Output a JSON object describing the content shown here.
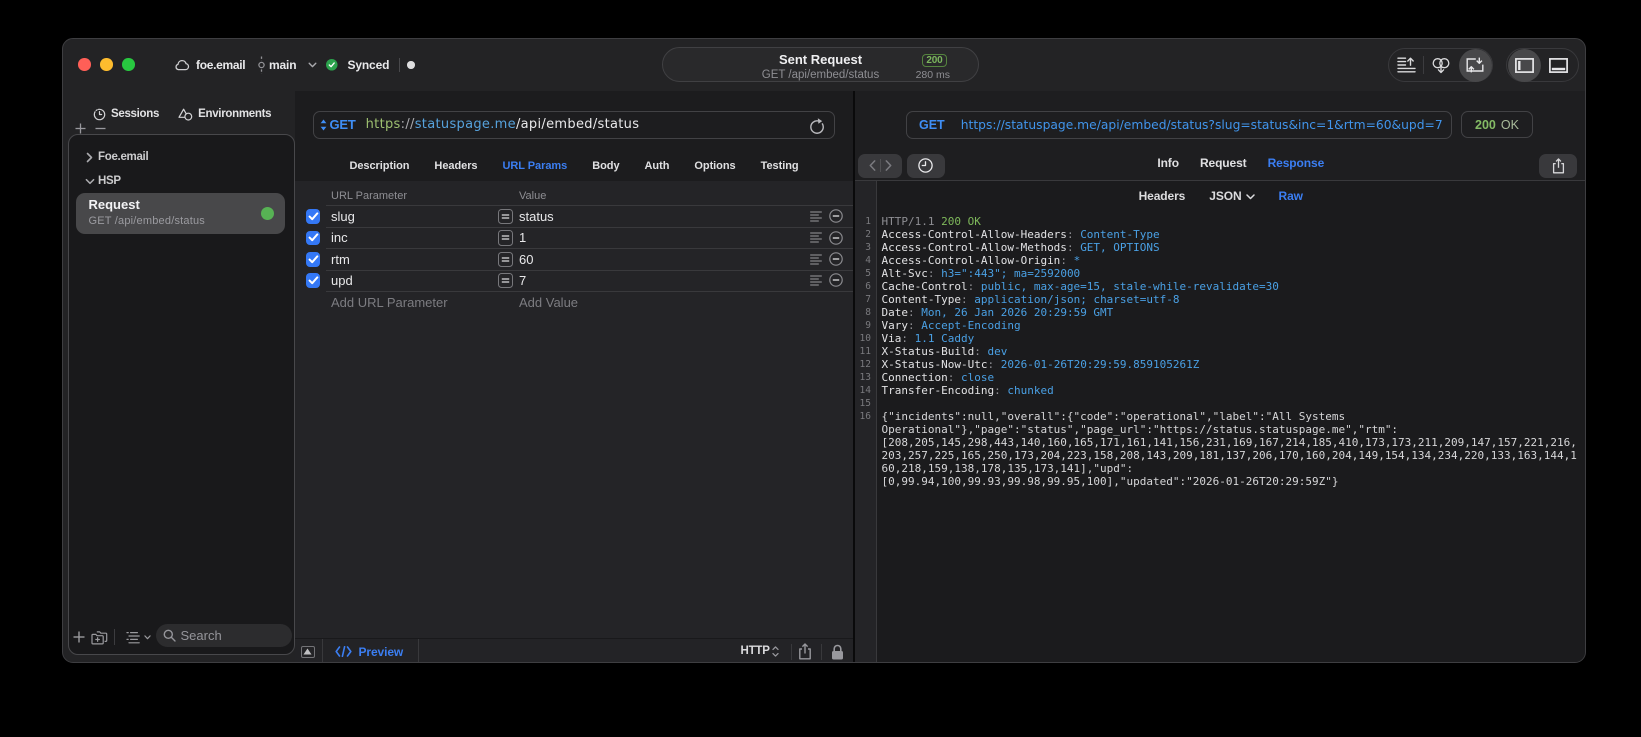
{
  "title_bar": {
    "project": "foe.email",
    "branch": "main",
    "sync_status": "Synced",
    "toast": {
      "title": "Sent Request",
      "subtitle": "GET /api/embed/status",
      "status_code": "200",
      "duration": "280 ms"
    }
  },
  "sidebar": {
    "tabs": [
      {
        "label": "Sessions",
        "icon": "clock-history-icon"
      },
      {
        "label": "Environments",
        "icon": "environments-icon"
      }
    ],
    "tree": [
      {
        "label": "Foe.email",
        "expanded": false
      },
      {
        "label": "HSP",
        "expanded": true
      }
    ],
    "selected_request": {
      "name": "Request",
      "summary": "GET /api/embed/status",
      "status_dot_color": "#57b254"
    },
    "search_placeholder": "Search"
  },
  "request_pane": {
    "method": "GET",
    "url": {
      "scheme": "https",
      "separator": "://",
      "host": "statuspage.me",
      "path": "/api/embed/status"
    },
    "tabs": [
      "Description",
      "Headers",
      "URL Params",
      "Body",
      "Auth",
      "Options",
      "Testing"
    ],
    "active_tab": "URL Params",
    "param_table": {
      "columns": [
        "URL Parameter",
        "Value"
      ],
      "rows": [
        {
          "name": "slug",
          "value": "status",
          "enabled": true
        },
        {
          "name": "inc",
          "value": "1",
          "enabled": true
        },
        {
          "name": "rtm",
          "value": "60",
          "enabled": true
        },
        {
          "name": "upd",
          "value": "7",
          "enabled": true
        }
      ],
      "add_param_placeholder": "Add URL Parameter",
      "add_value_placeholder": "Add Value"
    },
    "footer": {
      "preview_label": "Preview",
      "protocol": "HTTP"
    }
  },
  "response_pane": {
    "request_line": {
      "method": "GET",
      "url": "https://statuspage.me/api/embed/status?slug=status&inc=1&rtm=60&upd=7"
    },
    "status": {
      "code": "200",
      "text": "OK"
    },
    "tabs": [
      "Info",
      "Request",
      "Response"
    ],
    "active_tab": "Response",
    "subtabs": [
      "Headers",
      "JSON",
      "Raw"
    ],
    "active_subtab": "Raw",
    "status_line": {
      "protocol": "HTTP/1.1",
      "status": "200 OK"
    },
    "headers": [
      {
        "name": "Access-Control-Allow-Headers",
        "value": "Content-Type"
      },
      {
        "name": "Access-Control-Allow-Methods",
        "value": "GET, OPTIONS"
      },
      {
        "name": "Access-Control-Allow-Origin",
        "value": "*"
      },
      {
        "name": "Alt-Svc",
        "value": "h3=\":443\"; ma=2592000"
      },
      {
        "name": "Cache-Control",
        "value": "public, max-age=15, stale-while-revalidate=30"
      },
      {
        "name": "Content-Type",
        "value": "application/json; charset=utf-8"
      },
      {
        "name": "Date",
        "value": "Mon, 26 Jan 2026 20:29:59 GMT"
      },
      {
        "name": "Vary",
        "value": "Accept-Encoding"
      },
      {
        "name": "Via",
        "value": "1.1 Caddy"
      },
      {
        "name": "X-Status-Build",
        "value": "dev"
      },
      {
        "name": "X-Status-Now-Utc",
        "value": "2026-01-26T20:29:59.859105261Z"
      },
      {
        "name": "Connection",
        "value": "close"
      },
      {
        "name": "Transfer-Encoding",
        "value": "chunked"
      }
    ],
    "blank_line_number": 15,
    "body_line_number": 16,
    "body_lines": [
      "{\"incidents\":null,\"overall\":{\"code\":\"operational\",\"label\":\"All Systems",
      "Operational\"},\"page\":\"status\",\"page_url\":\"https://status.statuspage.me\",\"rtm\":",
      "[208,205,145,298,443,140,160,165,171,161,141,156,231,169,167,214,185,410,173,173,211,209,147,157,221,216,",
      "203,257,225,165,250,173,204,223,158,208,143,209,181,137,206,170,160,204,149,154,134,234,220,133,163,144,1",
      "60,218,159,138,178,135,173,141],\"upd\":",
      "[0,99.94,100,99.93,99.98,99.95,100],\"updated\":\"2026-01-26T20:29:59Z\"}"
    ]
  },
  "colors": {
    "accent_blue": "#3b7ef2",
    "code_value_blue": "#4aa0e4",
    "status_green": "#7fb95b",
    "checkbox_blue": "#3478f6",
    "traffic_red": "#ff5f57",
    "traffic_yellow": "#febc2e",
    "traffic_green": "#28c840"
  }
}
